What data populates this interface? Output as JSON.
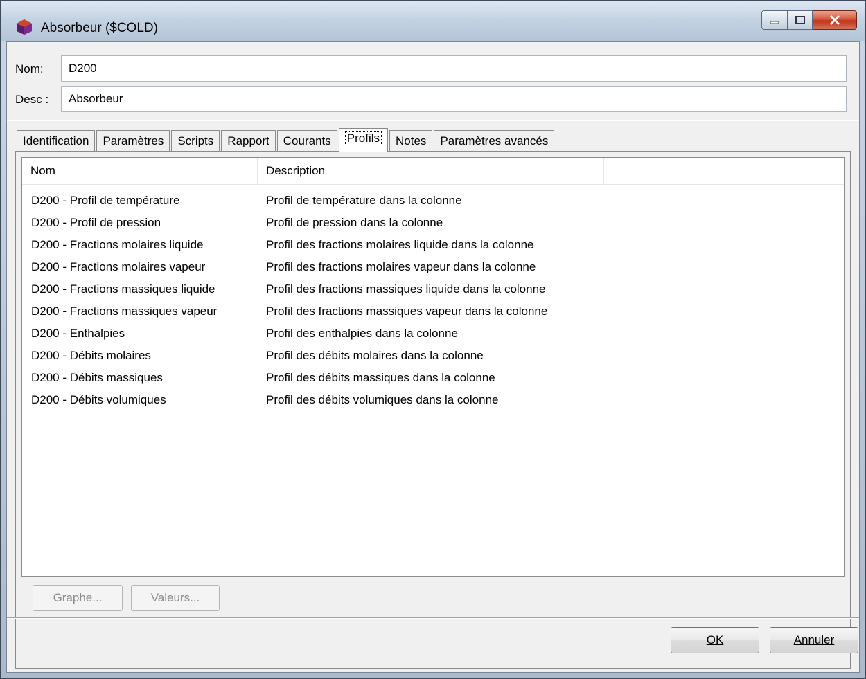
{
  "window": {
    "title": "Absorbeur ($COLD)",
    "controls": [
      "minimize-icon",
      "maximize-icon",
      "close-icon"
    ]
  },
  "fields": {
    "nom_label": "Nom:",
    "nom_value": "D200",
    "desc_label": "Desc :",
    "desc_value": "Absorbeur"
  },
  "tabs": [
    {
      "label": "Identification",
      "active": false
    },
    {
      "label": "Paramètres",
      "active": false
    },
    {
      "label": "Scripts",
      "active": false
    },
    {
      "label": "Rapport",
      "active": false
    },
    {
      "label": "Courants",
      "active": false
    },
    {
      "label": "Profils",
      "active": true
    },
    {
      "label": "Notes",
      "active": false
    },
    {
      "label": "Paramètres avancés",
      "active": false
    }
  ],
  "profiles": {
    "columns": [
      "Nom",
      "Description"
    ],
    "rows": [
      {
        "nom": "D200 - Profil de température",
        "description": "Profil de température dans la colonne"
      },
      {
        "nom": "D200 - Profil de pression",
        "description": "Profil de pression dans la colonne"
      },
      {
        "nom": "D200 - Fractions molaires liquide",
        "description": "Profil des fractions molaires liquide dans la colonne"
      },
      {
        "nom": "D200 - Fractions molaires vapeur",
        "description": "Profil des fractions molaires vapeur dans la colonne"
      },
      {
        "nom": "D200 - Fractions massiques liquide",
        "description": "Profil des fractions massiques liquide dans la colonne"
      },
      {
        "nom": "D200 - Fractions massiques vapeur",
        "description": "Profil des fractions massiques vapeur dans la colonne"
      },
      {
        "nom": "D200 - Enthalpies",
        "description": "Profil des enthalpies dans la colonne"
      },
      {
        "nom": "D200 - Débits molaires",
        "description": "Profil des débits molaires dans la colonne"
      },
      {
        "nom": "D200 - Débits massiques",
        "description": "Profil des débits massiques dans la colonne"
      },
      {
        "nom": "D200 - Débits volumiques",
        "description": "Profil des débits volumiques dans la colonne"
      }
    ],
    "graphe_label": "Graphe...",
    "valeurs_label": "Valeurs..."
  },
  "footer": {
    "ok_label": "OK",
    "annuler_label": "Annuler"
  },
  "colors": {
    "close_button": "#c0331a",
    "disabled_text": "#8d8d8d"
  }
}
